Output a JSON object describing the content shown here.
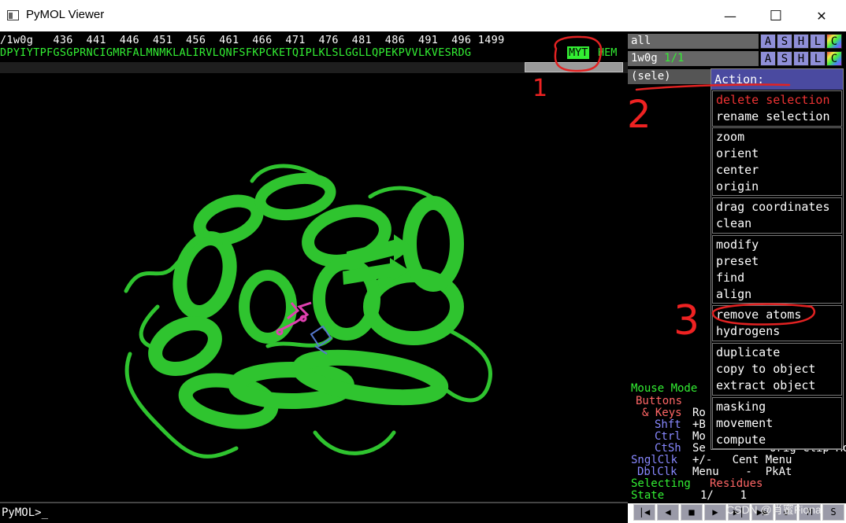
{
  "window": {
    "title": "PyMOL Viewer",
    "minimize": "—",
    "maximize": "☐",
    "close": "✕"
  },
  "sequence": {
    "numbers": "/1w0g   436  441  446  451  456  461  466  471  476  481  486  491  496 1499",
    "letters": "DPYIYTPFGSGPRNCIGMRFALMNMKLALIRVLQNFSFKPCKETQIPLKLSLGGLLQPEKPVVLKVESRDG",
    "selected": "MYT",
    "tail": "HEM"
  },
  "objects": [
    {
      "name": "all",
      "state": "",
      "buttons": [
        "A",
        "S",
        "H",
        "L",
        "C"
      ]
    },
    {
      "name": "1w0g",
      "state": "1/1",
      "buttons": [
        "A",
        "S",
        "H",
        "L",
        "C"
      ]
    }
  ],
  "selection": {
    "name": "(sele)"
  },
  "menu": {
    "header": "Action:",
    "groups": [
      [
        "delete selection",
        "rename selection"
      ],
      [
        "zoom",
        "orient",
        "center",
        "origin"
      ],
      [
        "drag coordinates",
        "clean"
      ],
      [
        "modify",
        "preset",
        "find",
        "align"
      ],
      [
        "remove atoms",
        "hydrogens"
      ],
      [
        "duplicate",
        "copy to object",
        "extract object"
      ],
      [
        "masking",
        "movement",
        "compute"
      ]
    ]
  },
  "mouse_panel": {
    "title": "Mouse Mode",
    "buttons": "Buttons",
    "keys": "& Keys",
    "rot": "Ro",
    "shft": "Shft",
    "shft_val": "+B",
    "ctrl": "Ctrl",
    "ctrl_val": "Mo",
    "ctsh": "CtSh",
    "ctsh_val": "Se",
    "ctsh_tail": "Orig Clip MovZ",
    "snglclk": "SnglClk",
    "snglclk_val": "+/-   Cent Menu",
    "dblclk": "DblClk",
    "dblclk_val": "Menu    -  PkAt",
    "selecting": "Selecting",
    "selecting_val": "Residues",
    "state": "State",
    "state_val": "1/    1"
  },
  "command": {
    "prompt": "PyMOL>_"
  },
  "annotations": {
    "one": "1",
    "two": "2",
    "three": "3"
  },
  "watermark": "CSDN @肖蜜Fiona",
  "colors": {
    "green": "#33ee33",
    "menu_header": "#4a4aa0",
    "red_annot": "#e22222"
  }
}
